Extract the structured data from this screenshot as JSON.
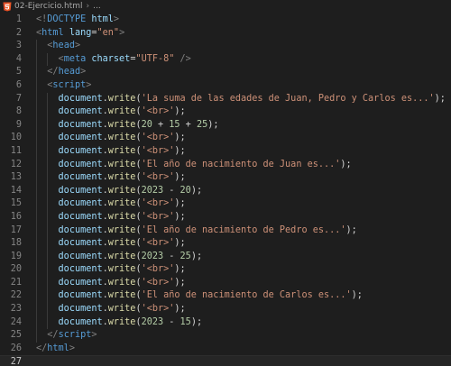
{
  "breadcrumb": {
    "file_name": "02-Ejercicio.html",
    "separator": "›",
    "ellipsis": "..."
  },
  "current_line": 27,
  "lines": [
    {
      "n": "1",
      "tokens": [
        [
          "bracket",
          "<!"
        ],
        [
          "doctype",
          "DOCTYPE"
        ],
        [
          "punct",
          " "
        ],
        [
          "attr",
          "html"
        ],
        [
          "bracket",
          ">"
        ]
      ]
    },
    {
      "n": "2",
      "tokens": [
        [
          "bracket",
          "<"
        ],
        [
          "tag",
          "html"
        ],
        [
          "punct",
          " "
        ],
        [
          "attr",
          "lang"
        ],
        [
          "punct",
          "="
        ],
        [
          "str",
          "\"en\""
        ],
        [
          "bracket",
          ">"
        ]
      ]
    },
    {
      "n": "3",
      "tokens": [
        [
          "punct",
          "  "
        ],
        [
          "bracket",
          "<"
        ],
        [
          "tag",
          "head"
        ],
        [
          "bracket",
          ">"
        ]
      ]
    },
    {
      "n": "4",
      "tokens": [
        [
          "punct",
          "    "
        ],
        [
          "bracket",
          "<"
        ],
        [
          "tag",
          "meta"
        ],
        [
          "punct",
          " "
        ],
        [
          "attr",
          "charset"
        ],
        [
          "punct",
          "="
        ],
        [
          "str",
          "\"UTF-8\""
        ],
        [
          "punct",
          " "
        ],
        [
          "bracket",
          "/>"
        ]
      ]
    },
    {
      "n": "5",
      "tokens": [
        [
          "punct",
          "  "
        ],
        [
          "bracket",
          "</"
        ],
        [
          "tag",
          "head"
        ],
        [
          "bracket",
          ">"
        ]
      ]
    },
    {
      "n": "6",
      "tokens": [
        [
          "punct",
          "  "
        ],
        [
          "bracket",
          "<"
        ],
        [
          "tag",
          "script"
        ],
        [
          "bracket",
          ">"
        ]
      ]
    },
    {
      "n": "7",
      "tokens": [
        [
          "punct",
          "    "
        ],
        [
          "obj",
          "document"
        ],
        [
          "punct",
          "."
        ],
        [
          "fn",
          "write"
        ],
        [
          "punct",
          "("
        ],
        [
          "str",
          "'La suma de las edades de Juan, Pedro y Carlos es...'"
        ],
        [
          "punct",
          ");"
        ]
      ]
    },
    {
      "n": "8",
      "tokens": [
        [
          "punct",
          "    "
        ],
        [
          "obj",
          "document"
        ],
        [
          "punct",
          "."
        ],
        [
          "fn",
          "write"
        ],
        [
          "punct",
          "("
        ],
        [
          "str",
          "'<br>'"
        ],
        [
          "punct",
          ");"
        ]
      ]
    },
    {
      "n": "9",
      "tokens": [
        [
          "punct",
          "    "
        ],
        [
          "obj",
          "document"
        ],
        [
          "punct",
          "."
        ],
        [
          "fn",
          "write"
        ],
        [
          "punct",
          "("
        ],
        [
          "num",
          "20"
        ],
        [
          "op",
          " + "
        ],
        [
          "num",
          "15"
        ],
        [
          "op",
          " + "
        ],
        [
          "num",
          "25"
        ],
        [
          "punct",
          ");"
        ]
      ]
    },
    {
      "n": "10",
      "tokens": [
        [
          "punct",
          "    "
        ],
        [
          "obj",
          "document"
        ],
        [
          "punct",
          "."
        ],
        [
          "fn",
          "write"
        ],
        [
          "punct",
          "("
        ],
        [
          "str",
          "'<br>'"
        ],
        [
          "punct",
          ");"
        ]
      ]
    },
    {
      "n": "11",
      "tokens": [
        [
          "punct",
          "    "
        ],
        [
          "obj",
          "document"
        ],
        [
          "punct",
          "."
        ],
        [
          "fn",
          "write"
        ],
        [
          "punct",
          "("
        ],
        [
          "str",
          "'<br>'"
        ],
        [
          "punct",
          ");"
        ]
      ]
    },
    {
      "n": "12",
      "tokens": [
        [
          "punct",
          "    "
        ],
        [
          "obj",
          "document"
        ],
        [
          "punct",
          "."
        ],
        [
          "fn",
          "write"
        ],
        [
          "punct",
          "("
        ],
        [
          "str",
          "'El año de nacimiento de Juan es...'"
        ],
        [
          "punct",
          ");"
        ]
      ]
    },
    {
      "n": "13",
      "tokens": [
        [
          "punct",
          "    "
        ],
        [
          "obj",
          "document"
        ],
        [
          "punct",
          "."
        ],
        [
          "fn",
          "write"
        ],
        [
          "punct",
          "("
        ],
        [
          "str",
          "'<br>'"
        ],
        [
          "punct",
          ");"
        ]
      ]
    },
    {
      "n": "14",
      "tokens": [
        [
          "punct",
          "    "
        ],
        [
          "obj",
          "document"
        ],
        [
          "punct",
          "."
        ],
        [
          "fn",
          "write"
        ],
        [
          "punct",
          "("
        ],
        [
          "num",
          "2023"
        ],
        [
          "op",
          " - "
        ],
        [
          "num",
          "20"
        ],
        [
          "punct",
          ");"
        ]
      ]
    },
    {
      "n": "15",
      "tokens": [
        [
          "punct",
          "    "
        ],
        [
          "obj",
          "document"
        ],
        [
          "punct",
          "."
        ],
        [
          "fn",
          "write"
        ],
        [
          "punct",
          "("
        ],
        [
          "str",
          "'<br>'"
        ],
        [
          "punct",
          ");"
        ]
      ]
    },
    {
      "n": "16",
      "tokens": [
        [
          "punct",
          "    "
        ],
        [
          "obj",
          "document"
        ],
        [
          "punct",
          "."
        ],
        [
          "fn",
          "write"
        ],
        [
          "punct",
          "("
        ],
        [
          "str",
          "'<br>'"
        ],
        [
          "punct",
          ");"
        ]
      ]
    },
    {
      "n": "17",
      "tokens": [
        [
          "punct",
          "    "
        ],
        [
          "obj",
          "document"
        ],
        [
          "punct",
          "."
        ],
        [
          "fn",
          "write"
        ],
        [
          "punct",
          "("
        ],
        [
          "str",
          "'El año de nacimiento de Pedro es...'"
        ],
        [
          "punct",
          ");"
        ]
      ]
    },
    {
      "n": "18",
      "tokens": [
        [
          "punct",
          "    "
        ],
        [
          "obj",
          "document"
        ],
        [
          "punct",
          "."
        ],
        [
          "fn",
          "write"
        ],
        [
          "punct",
          "("
        ],
        [
          "str",
          "'<br>'"
        ],
        [
          "punct",
          ");"
        ]
      ]
    },
    {
      "n": "19",
      "tokens": [
        [
          "punct",
          "    "
        ],
        [
          "obj",
          "document"
        ],
        [
          "punct",
          "."
        ],
        [
          "fn",
          "write"
        ],
        [
          "punct",
          "("
        ],
        [
          "num",
          "2023"
        ],
        [
          "op",
          " - "
        ],
        [
          "num",
          "25"
        ],
        [
          "punct",
          ");"
        ]
      ]
    },
    {
      "n": "20",
      "tokens": [
        [
          "punct",
          "    "
        ],
        [
          "obj",
          "document"
        ],
        [
          "punct",
          "."
        ],
        [
          "fn",
          "write"
        ],
        [
          "punct",
          "("
        ],
        [
          "str",
          "'<br>'"
        ],
        [
          "punct",
          ");"
        ]
      ]
    },
    {
      "n": "21",
      "tokens": [
        [
          "punct",
          "    "
        ],
        [
          "obj",
          "document"
        ],
        [
          "punct",
          "."
        ],
        [
          "fn",
          "write"
        ],
        [
          "punct",
          "("
        ],
        [
          "str",
          "'<br>'"
        ],
        [
          "punct",
          ");"
        ]
      ]
    },
    {
      "n": "22",
      "tokens": [
        [
          "punct",
          "    "
        ],
        [
          "obj",
          "document"
        ],
        [
          "punct",
          "."
        ],
        [
          "fn",
          "write"
        ],
        [
          "punct",
          "("
        ],
        [
          "str",
          "'El año de nacimiento de Carlos es...'"
        ],
        [
          "punct",
          ");"
        ]
      ]
    },
    {
      "n": "23",
      "tokens": [
        [
          "punct",
          "    "
        ],
        [
          "obj",
          "document"
        ],
        [
          "punct",
          "."
        ],
        [
          "fn",
          "write"
        ],
        [
          "punct",
          "("
        ],
        [
          "str",
          "'<br>'"
        ],
        [
          "punct",
          ");"
        ]
      ]
    },
    {
      "n": "24",
      "tokens": [
        [
          "punct",
          "    "
        ],
        [
          "obj",
          "document"
        ],
        [
          "punct",
          "."
        ],
        [
          "fn",
          "write"
        ],
        [
          "punct",
          "("
        ],
        [
          "num",
          "2023"
        ],
        [
          "op",
          " - "
        ],
        [
          "num",
          "15"
        ],
        [
          "punct",
          ");"
        ]
      ]
    },
    {
      "n": "25",
      "tokens": [
        [
          "punct",
          "  "
        ],
        [
          "bracket",
          "</"
        ],
        [
          "tag",
          "script"
        ],
        [
          "bracket",
          ">"
        ]
      ]
    },
    {
      "n": "26",
      "tokens": [
        [
          "bracket",
          "</"
        ],
        [
          "tag",
          "html"
        ],
        [
          "bracket",
          ">"
        ]
      ]
    },
    {
      "n": "27",
      "tokens": []
    }
  ]
}
